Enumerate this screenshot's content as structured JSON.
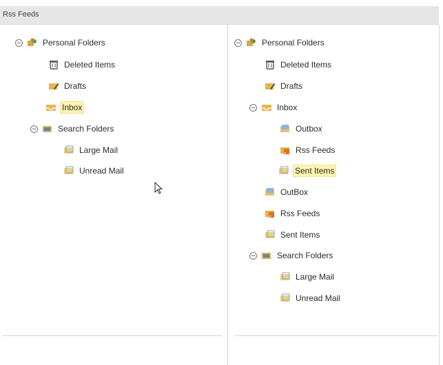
{
  "header": {
    "title": "Rss Feeds"
  },
  "left_tree": {
    "personal_folders": "Personal Folders",
    "deleted_items": "Deleted Items",
    "drafts": "Drafts",
    "inbox": "Inbox",
    "search_folders": "Search Folders",
    "large_mail": "Large Mail",
    "unread_mail": "Unread Mail"
  },
  "right_tree": {
    "personal_folders": "Personal Folders",
    "deleted_items": "Deleted Items",
    "drafts": "Drafts",
    "inbox": "Inbox",
    "inbox_outbox": "Outbox",
    "inbox_rss_feeds": "Rss Feeds",
    "inbox_sent_items": "Sent Items",
    "outbox": "OutBox",
    "rss_feeds": "Rss Feeds",
    "sent_items": "Sent Items",
    "search_folders": "Search Folders",
    "large_mail": "Large Mail",
    "unread_mail": "Unread Mail"
  },
  "toggle_symbol": "⊖",
  "icons": {
    "personal": "personal-folders-icon",
    "deleted": "deleted-items-icon",
    "drafts": "drafts-icon",
    "inbox": "inbox-icon",
    "search": "search-folders-icon",
    "folder": "folder-icon",
    "rss": "rss-feeds-icon"
  },
  "colors": {
    "selection": "#fff3b0",
    "header_bg": "#e6e6e6"
  }
}
